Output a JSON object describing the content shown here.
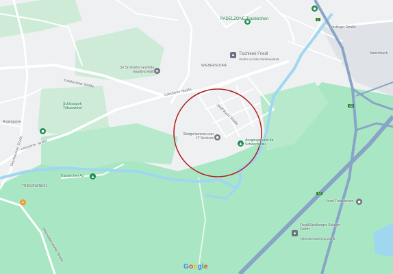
{
  "map": {
    "attribution": "Google",
    "highlight_circle_color": "#b31b1b",
    "colors": {
      "park": "#cdebd6",
      "open": "#a8e6c4",
      "water": "#9fd7f0",
      "highway": "#8aa4c8",
      "road": "#ffffff",
      "urban": "#e9ebee"
    }
  },
  "pois": {
    "padelzone": "PADELZONE Traiskirchen",
    "tischlerei": "Tischlerei Friedl",
    "tischlerei_sub": "Stufen wo bab Gardensauhet",
    "radha": "Sri Sri Radha Govinda Gaudiya Math",
    "schlosspark": "Schlosspark Tribuswinkel",
    "sledgehammer": "Sledgehammer.com -IT Services",
    "ausgangspunkt": "Ausgangspunkt für Schwechatau",
    "traisen": "Traiskirchen Au",
    "fiegl": "Fiegl&Spielberger Solution GmbH",
    "fiegl_sub": "Videoüberwachung Zutritt",
    "tischlerei2": "Josef Traiskirchen"
  },
  "streets": {
    "triestinger": "Triestinger Straße",
    "traiskirchner": "Traiskirchner Straße",
    "leesdorfer": "Leesdorfer Straße",
    "josef_buchl": "Josef Buchl Straße",
    "wienersdorf": "WIENERSDORF",
    "tribuswinkel": "TRIBUSWINKEL",
    "oeynhausner": "Oeynhausner Straße",
    "oberwaltersdorfer": "Oberwaltersdorfer Straße",
    "natschbach": "Natschbach",
    "gaudiya": "Mahlgasse",
    "angergasse": "Angergasse",
    "fasanengasse": "Fasangasse"
  },
  "shields": {
    "a2_top": "2",
    "a2_mid": "A2",
    "a2_low": "A2"
  }
}
